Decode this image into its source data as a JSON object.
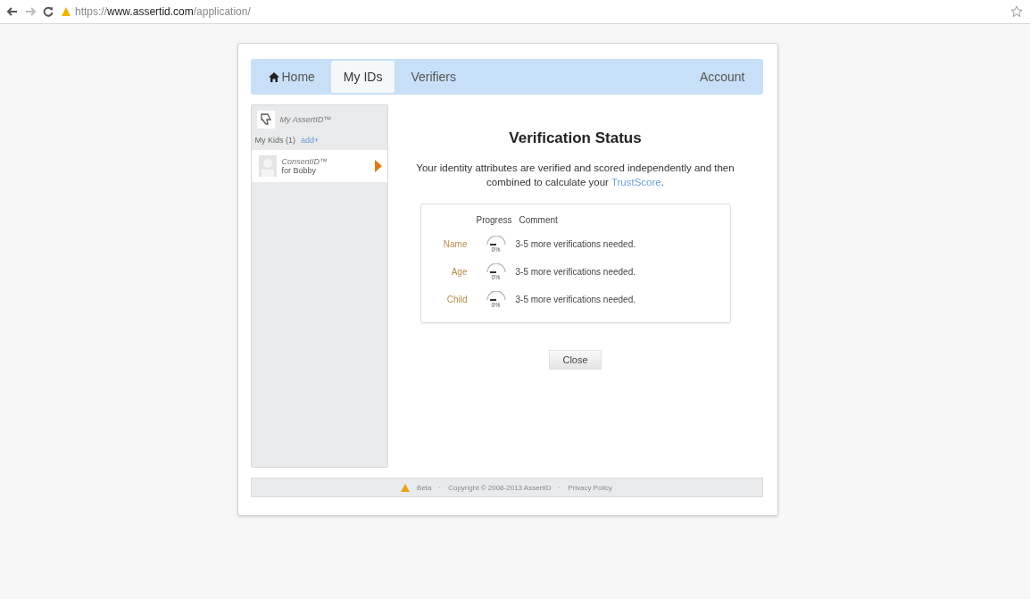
{
  "browser": {
    "url_prefix": "https://",
    "url_host": "www.assertid.com",
    "url_path": "/application/"
  },
  "nav": {
    "tabs": [
      {
        "label": "Home",
        "kind": "home",
        "selected": false
      },
      {
        "label": "My IDs",
        "kind": "plain",
        "selected": true
      },
      {
        "label": "Verifiers",
        "kind": "plain",
        "selected": false
      }
    ],
    "account": "Account"
  },
  "sidebar": {
    "title": "My AssertID™",
    "kids_label": "My Kids (1)",
    "add_link": "add+",
    "items": [
      {
        "name": "ConsentID™",
        "subtitle": "for Bobby",
        "selected": true
      }
    ]
  },
  "main": {
    "title": "Verification Status",
    "intro": "Your identity attributes are verified and scored independently and then combined to calculate your ",
    "intro_link": "TrustScore",
    "intro_end": ".",
    "table": {
      "columns": [
        "Progress",
        "Comment"
      ],
      "rows": [
        {
          "attribute": "Name",
          "reading": "0%",
          "comment": "3-5 more verifications needed."
        },
        {
          "attribute": "Age",
          "reading": "0%",
          "comment": "3-5 more verifications needed."
        },
        {
          "attribute": "Child",
          "reading": "0%",
          "comment": "3-5 more verifications needed."
        }
      ]
    },
    "close_button": "Close"
  },
  "footer": {
    "beta": "Beta",
    "separator_1": "·",
    "copyright": "Copyright © 2008-2013 AssertID",
    "separator_2": "·",
    "privacy": "Privacy Policy"
  }
}
